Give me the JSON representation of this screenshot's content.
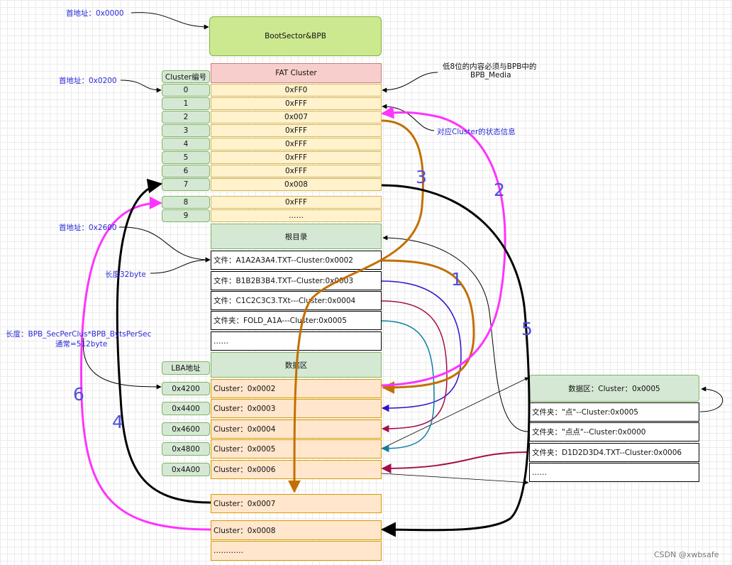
{
  "labels": {
    "addr_0000": "首地址：0x0000",
    "addr_0200": "首地址：0x0200",
    "addr_2600": "首地址：0x2600",
    "len32": "长度32byte",
    "len_sec": "长度：BPB_SecPerClus*BPB_BytsPerSec",
    "len_sec2": "通常=512byte",
    "note_low8": "低8位的内容必须与BPB中的",
    "note_low8_2": "BPB_Media",
    "note_status": "对应Cluster的状态信息",
    "watermark": "CSDN @xwbsafe"
  },
  "boot": "BootSector&BPB",
  "fat": {
    "header": "FAT Cluster",
    "num_header": "Cluster编号",
    "nums": [
      "0",
      "1",
      "2",
      "3",
      "4",
      "5",
      "6",
      "7"
    ],
    "values": [
      "0xFF0",
      "0xFFF",
      "0x007",
      "0xFFF",
      "0xFFF",
      "0xFFF",
      "0xFFF",
      "0x008"
    ],
    "nums2": [
      "8",
      "9"
    ],
    "values2": [
      "0xFFF",
      "……"
    ]
  },
  "root": {
    "header": "根目录",
    "entries": [
      "文件：A1A2A3A4.TXT--Cluster:0x0002",
      "文件：B1B2B3B4.TXT--Cluster:0x0003",
      "文件：C1C2C3C3.TXt---Cluster:0x0004",
      "文件夹：FOLD_A1A---Cluster:0x0005",
      "……"
    ]
  },
  "data": {
    "header": "数据区",
    "lba_header": "LBA地址",
    "lba": [
      "0x4200",
      "0x4400",
      "0x4600",
      "0x4800",
      "0x4A00"
    ],
    "clusters": [
      "Cluster：0x0002",
      "Cluster：0x0003",
      "Cluster：0x0004",
      "Cluster：0x0005",
      "Cluster：0x0006"
    ],
    "cluster7": "Cluster：0x0007",
    "cluster8": "Cluster：0x0008",
    "more": "…………"
  },
  "right": {
    "header": "数据区：Cluster：0x0005",
    "entries": [
      "文件夹：\"点\"--Cluster:0x0005",
      "文件夹：\"点点\"--Cluster:0x0000",
      "文件夹：D1D2D3D4.TXT--Cluster:0x0006",
      "……"
    ]
  },
  "numbers": [
    "1",
    "2",
    "3",
    "4",
    "5",
    "6"
  ],
  "colors": {
    "magenta": "#ff33ff",
    "brown": "#c27000",
    "purple": "#3311cc",
    "crimson": "#a50e4a",
    "teal": "#0e7ea5",
    "black": "#000000"
  }
}
